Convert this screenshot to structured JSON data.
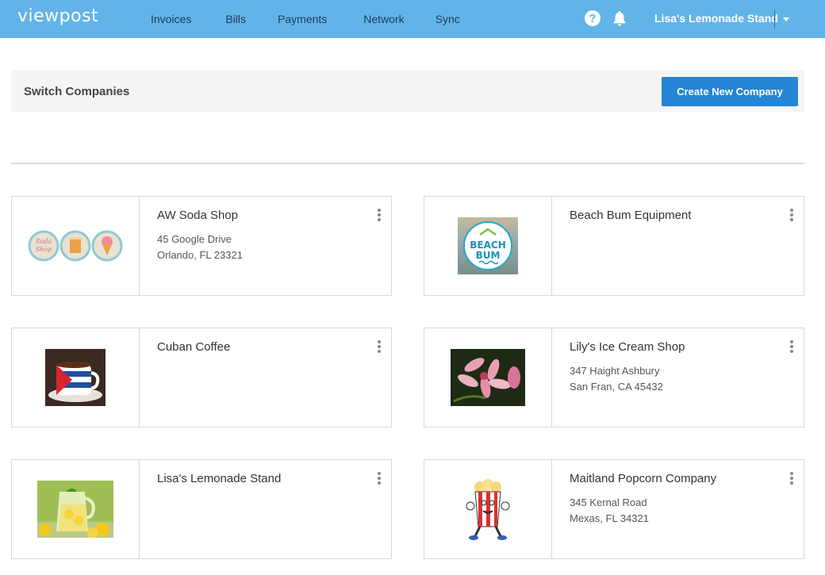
{
  "header": {
    "logo": "viewpost",
    "nav": [
      "Invoices",
      "Bills",
      "Payments",
      "Network",
      "Sync"
    ],
    "help_icon": "question-circle-icon",
    "bell_icon": "bell-icon",
    "current_company": "Lisa's Lemonade Stand"
  },
  "switch_bar": {
    "title": "Switch Companies",
    "create_button": "Create New Company"
  },
  "companies": [
    {
      "name": "AW Soda Shop",
      "address1": "45 Google Drive",
      "address2": "Orlando, FL 23321"
    },
    {
      "name": "Beach Bum Equipment",
      "address1": "",
      "address2": "",
      "logo_text1": "BEACH",
      "logo_text2": "BUM"
    },
    {
      "name": "Cuban Coffee",
      "address1": "",
      "address2": ""
    },
    {
      "name": "Lily's Ice Cream Shop",
      "address1": "347 Haight Ashbury",
      "address2": "San Fran, CA 45432"
    },
    {
      "name": "Lisa's Lemonade Stand",
      "address1": "",
      "address2": ""
    },
    {
      "name": "Maitland Popcorn Company",
      "address1": "345 Kernal Road",
      "address2": "Mexas, FL 34321"
    }
  ],
  "colors": {
    "topbar": "#62b4e8",
    "primary_button": "#2585d6"
  }
}
